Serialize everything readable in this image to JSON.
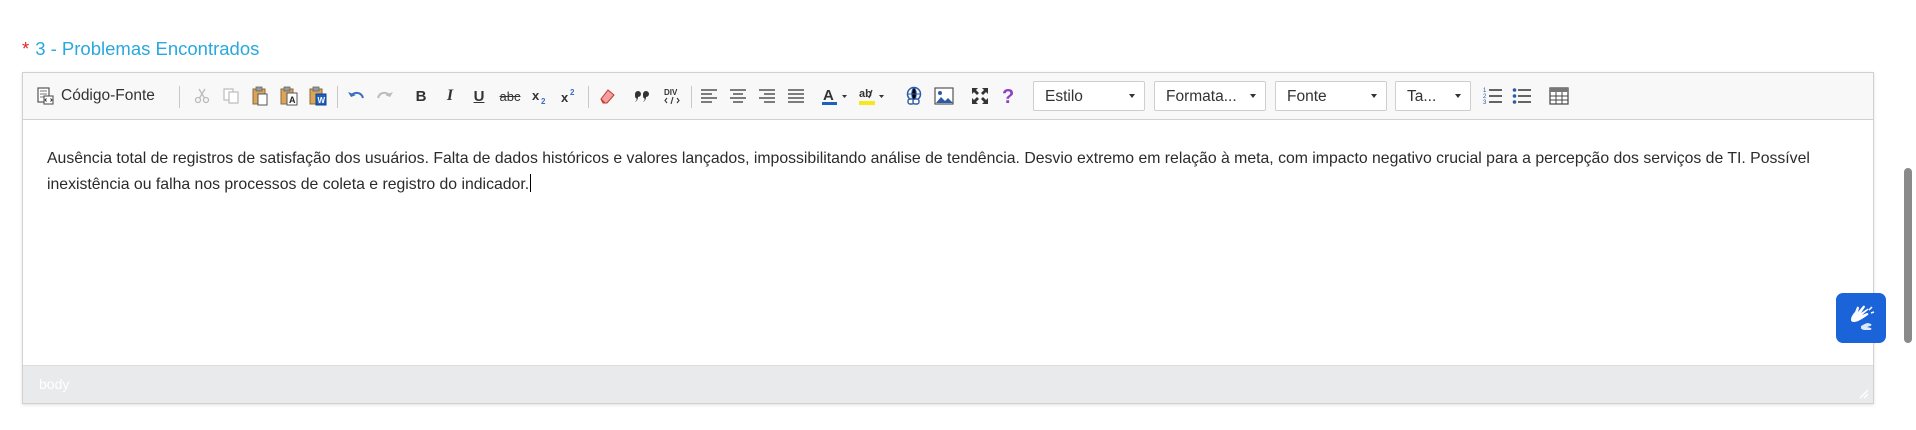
{
  "section": {
    "required_mark": "*",
    "title": "3 - Problemas Encontrados"
  },
  "toolbar": {
    "source_label": "Código-Fonte",
    "bold": "B",
    "italic": "I",
    "underline": "U",
    "strike": "abc",
    "style_combo": "Estilo",
    "format_combo": "Formata...",
    "font_combo": "Fonte",
    "size_combo": "Ta..."
  },
  "content": {
    "text": "Ausência total de registros de satisfação dos usuários. Falta de dados históricos e valores lançados, impossibilitando análise de tendência. Desvio extremo em relação à meta, com impacto negativo crucial para a percepção dos serviços de TI. Possível inexistência ou falha nos processos de coleta e registro do indicador."
  },
  "status": {
    "path": "body"
  },
  "colors": {
    "accent": "#29a8e0",
    "required": "#e3262a",
    "vlibras": "#1a63d8"
  }
}
